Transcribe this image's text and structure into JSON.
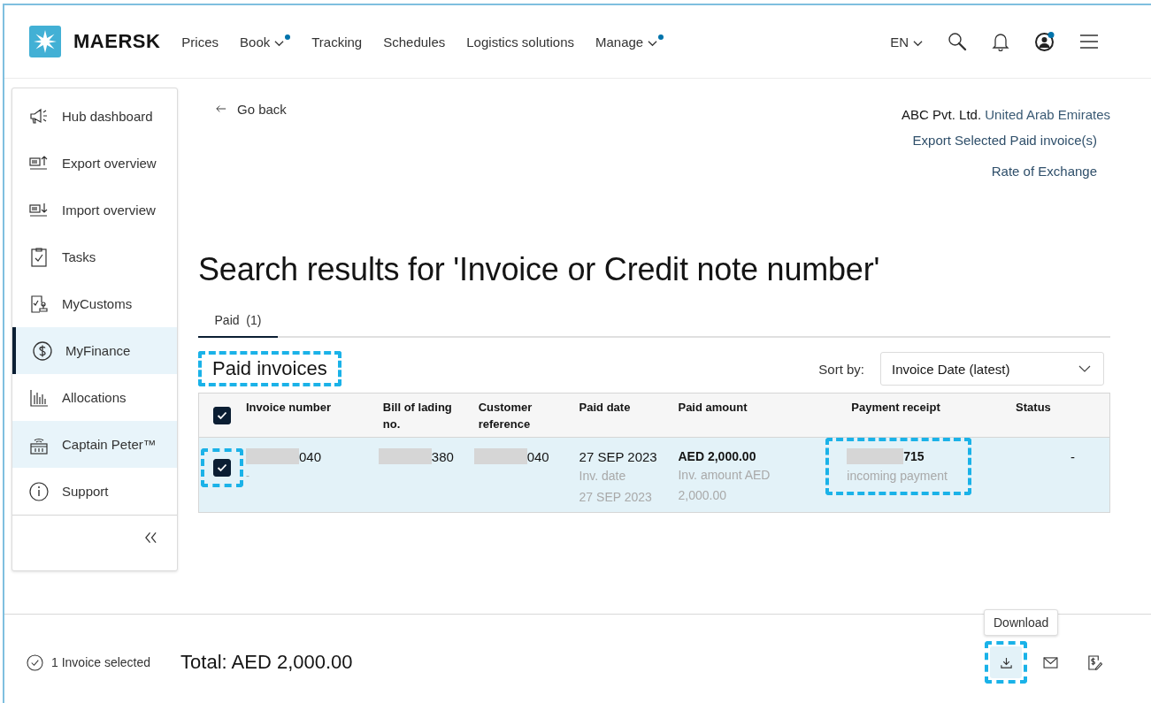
{
  "header": {
    "logo_text": "MAERSK",
    "nav": [
      {
        "label": "Prices",
        "dropdown": false,
        "dot": false
      },
      {
        "label": "Book",
        "dropdown": true,
        "dot": true
      },
      {
        "label": "Tracking",
        "dropdown": false,
        "dot": false
      },
      {
        "label": "Schedules",
        "dropdown": false,
        "dot": false
      },
      {
        "label": "Logistics solutions",
        "dropdown": false,
        "dot": false
      },
      {
        "label": "Manage",
        "dropdown": true,
        "dot": true
      }
    ],
    "language": "EN",
    "profile_dot": true
  },
  "sidebar": {
    "items": [
      {
        "kind": "megaphone",
        "label": "Hub dashboard",
        "selected": false,
        "hovered": false
      },
      {
        "kind": "export",
        "label": "Export overview",
        "selected": false,
        "hovered": false
      },
      {
        "kind": "import",
        "label": "Import overview",
        "selected": false,
        "hovered": false
      },
      {
        "kind": "tasks",
        "label": "Tasks",
        "selected": false,
        "hovered": false
      },
      {
        "kind": "customs",
        "label": "MyCustoms",
        "selected": false,
        "hovered": false
      },
      {
        "kind": "finance",
        "label": "MyFinance",
        "selected": true,
        "hovered": false
      },
      {
        "kind": "allocations",
        "label": "Allocations",
        "selected": false,
        "hovered": false
      },
      {
        "kind": "assistant",
        "label": "Captain Peter™",
        "selected": false,
        "hovered": true
      },
      {
        "kind": "support",
        "label": "Support",
        "selected": false,
        "hovered": false
      }
    ]
  },
  "go_back": "Go back",
  "account": {
    "company": "ABC Pvt. Ltd.",
    "country": "United Arab Emirates"
  },
  "links": [
    "Export Selected Paid invoice(s)",
    "Rate of Exchange"
  ],
  "title": "Search results for 'Invoice or Credit note number'",
  "tabs": [
    {
      "label": "Paid  (1)",
      "selected": true
    }
  ],
  "section": {
    "heading": "Paid invoices",
    "highlighted": true
  },
  "sort": {
    "label": "Sort by:",
    "value": "Invoice Date (latest)"
  },
  "table": {
    "all_checked": true,
    "columns": [
      "Invoice number",
      "Bill of lading no.",
      "Customer reference",
      "Paid date",
      "Paid amount",
      "Payment receipt",
      "Status"
    ],
    "rows": [
      {
        "selected": true,
        "checkbox_highlighted": true,
        "invoice_number": "040",
        "invoice_note": "-",
        "bill_of_lading": "380",
        "customer_reference": "040",
        "paid_date": "27 SEP 2023",
        "inv_date_label": "Inv. date",
        "inv_date": "27 SEP 2023",
        "paid_amount": "AED 2,000.00",
        "inv_amount": "Inv. amount AED 2,000.00",
        "payment_receipt": "715",
        "receipt_note": "incoming payment",
        "receipt_highlighted": true,
        "status": "-"
      }
    ]
  },
  "footer": {
    "selection": "1 Invoice selected",
    "total": "Total: AED 2,000.00",
    "actions": [
      {
        "kind": "download",
        "tooltip": "Download",
        "highlighted": true
      },
      {
        "kind": "email",
        "highlighted": false
      },
      {
        "kind": "invoice",
        "highlighted": false
      }
    ]
  }
}
